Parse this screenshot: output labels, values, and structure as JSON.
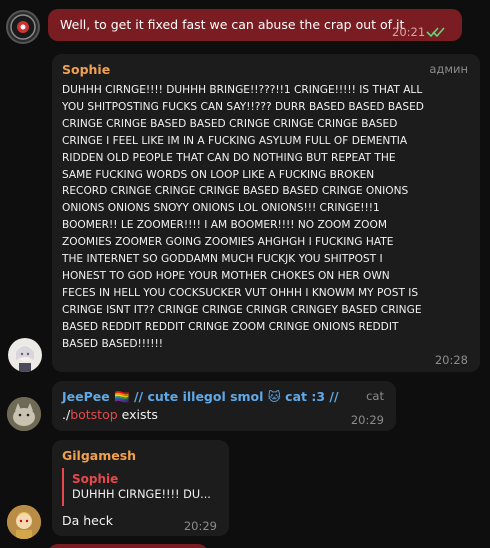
{
  "messages": {
    "outgoing": {
      "text": "Well, to get it fixed fast we can abuse the crap out of it",
      "time": "20:21",
      "status_icon": "double-check-icon"
    },
    "sophie": {
      "sender": "Sophie",
      "role": "админ",
      "lines": [
        "DUHHH CIRNGE!!!! DUHHH BRINGE!!???!!1 CRINGE!!!!! IS THAT ALL",
        "YOU SHITPOSTING FUCKS CAN SAY!!??? DURR BASED BASED BASED",
        "CRINGE CRINGE BASED BASED CRINGE CRINGE CRINGE BASED",
        "CRINGE I FEEL LIKE IM IN A FUCKING ASYLUM FULL OF DEMENTIA",
        "RIDDEN OLD PEOPLE THAT CAN DO NOTHING BUT REPEAT THE",
        "SAME FUCKING WORDS ON LOOP LIKE A FUCKING BROKEN",
        "RECORD CRINGE CRINGE CRINGE BASED BASED CRINGE ONIONS",
        "ONIONS ONIONS SNOYY ONIONS LOL ONIONS!!! CRINGE!!!1",
        "BOOMER!! LE ZOOMER!!!! I AM BOOMER!!!! NO ZOOM ZOOM",
        "ZOOMIES ZOOMER GOING ZOOMIES AHGHGH I FUCKING HATE",
        "THE INTERNET SO GODDAMN MUCH FUCKJK YOU SHITPOST I",
        "HONEST TO GOD HOPE YOUR MOTHER CHOKES ON HER OWN",
        "FECES IN HELL YOU COCKSUCKER VUT OHHH I KNOWM MY POST IS",
        "CRINGE ISNT IT?? CRINGE CRINGE CRINGR CRINGEY BASED CRINGE",
        "BASED REDDIT REDDIT CRINGE ZOOM CRINGE ONIONS REDDIT",
        "BASED BASED!!!!!!"
      ],
      "time": "20:28"
    },
    "jeepee": {
      "sender": "JeePee 🏳️‍🌈 // cute illegol smol 🐱 cat :3 //",
      "role": "cat",
      "command_prefix": "./",
      "command": "botstop",
      "command_suffix": " exists",
      "time": "20:29"
    },
    "gilgamesh": {
      "sender": "Gilgamesh",
      "reply_sender": "Sophie",
      "reply_preview": "DUHHH CIRNGE!!!! DU...",
      "text": "Da heck",
      "time": "20:29"
    }
  },
  "colors": {
    "outgoing_bubble": "#7a1d22",
    "incoming_bubble": "#1c1c1c",
    "sophie_name": "#f0a150",
    "jeepee_name": "#5fa9e8",
    "gilgamesh_name": "#f0a150",
    "reply_accent": "#e5484d",
    "check_color": "#6ad17e"
  }
}
